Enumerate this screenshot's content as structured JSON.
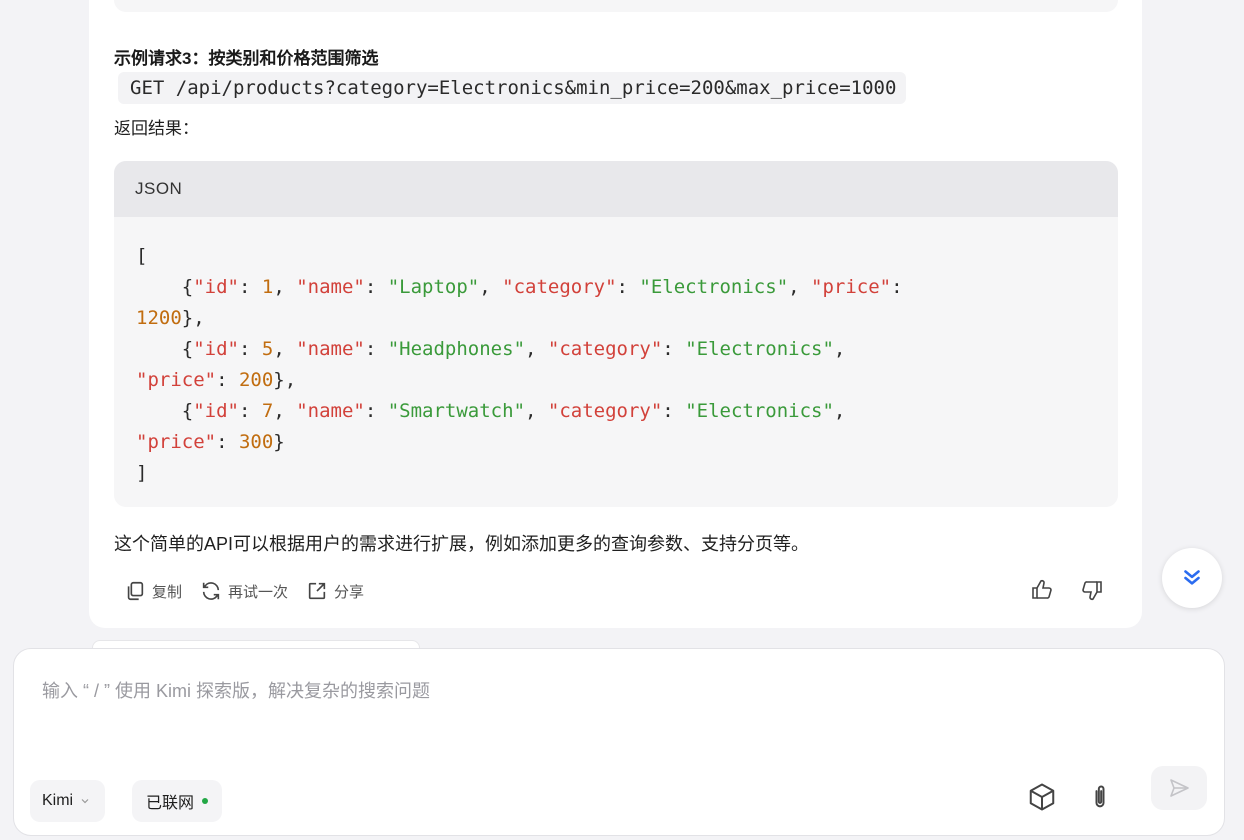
{
  "message": {
    "request_heading": "示例请求3：按类别和价格范围筛选",
    "request_code": "GET /api/products?category=Electronics&min_price=200&max_price=1000",
    "result_label": "返回结果：",
    "code_block": {
      "language": "JSON",
      "lines": [
        [
          {
            "t": "p",
            "v": "["
          }
        ],
        [
          {
            "t": "p",
            "v": "    {"
          },
          {
            "t": "k",
            "v": "\"id\""
          },
          {
            "t": "p",
            "v": ": "
          },
          {
            "t": "n",
            "v": "1"
          },
          {
            "t": "p",
            "v": ", "
          },
          {
            "t": "k",
            "v": "\"name\""
          },
          {
            "t": "p",
            "v": ": "
          },
          {
            "t": "s",
            "v": "\"Laptop\""
          },
          {
            "t": "p",
            "v": ", "
          },
          {
            "t": "k",
            "v": "\"category\""
          },
          {
            "t": "p",
            "v": ": "
          },
          {
            "t": "s",
            "v": "\"Electronics\""
          },
          {
            "t": "p",
            "v": ", "
          },
          {
            "t": "k",
            "v": "\"price\""
          },
          {
            "t": "p",
            "v": ":"
          }
        ],
        [
          {
            "t": "n",
            "v": "1200"
          },
          {
            "t": "p",
            "v": "},"
          }
        ],
        [
          {
            "t": "p",
            "v": "    {"
          },
          {
            "t": "k",
            "v": "\"id\""
          },
          {
            "t": "p",
            "v": ": "
          },
          {
            "t": "n",
            "v": "5"
          },
          {
            "t": "p",
            "v": ", "
          },
          {
            "t": "k",
            "v": "\"name\""
          },
          {
            "t": "p",
            "v": ": "
          },
          {
            "t": "s",
            "v": "\"Headphones\""
          },
          {
            "t": "p",
            "v": ", "
          },
          {
            "t": "k",
            "v": "\"category\""
          },
          {
            "t": "p",
            "v": ": "
          },
          {
            "t": "s",
            "v": "\"Electronics\""
          },
          {
            "t": "p",
            "v": ","
          }
        ],
        [
          {
            "t": "k",
            "v": "\"price\""
          },
          {
            "t": "p",
            "v": ": "
          },
          {
            "t": "n",
            "v": "200"
          },
          {
            "t": "p",
            "v": "},"
          }
        ],
        [
          {
            "t": "p",
            "v": "    {"
          },
          {
            "t": "k",
            "v": "\"id\""
          },
          {
            "t": "p",
            "v": ": "
          },
          {
            "t": "n",
            "v": "7"
          },
          {
            "t": "p",
            "v": ", "
          },
          {
            "t": "k",
            "v": "\"name\""
          },
          {
            "t": "p",
            "v": ": "
          },
          {
            "t": "s",
            "v": "\"Smartwatch\""
          },
          {
            "t": "p",
            "v": ", "
          },
          {
            "t": "k",
            "v": "\"category\""
          },
          {
            "t": "p",
            "v": ": "
          },
          {
            "t": "s",
            "v": "\"Electronics\""
          },
          {
            "t": "p",
            "v": ","
          }
        ],
        [
          {
            "t": "k",
            "v": "\"price\""
          },
          {
            "t": "p",
            "v": ": "
          },
          {
            "t": "n",
            "v": "300"
          },
          {
            "t": "p",
            "v": "}"
          }
        ],
        [
          {
            "t": "p",
            "v": "]"
          }
        ]
      ]
    },
    "footer_text": "这个简单的API可以根据用户的需求进行扩展，例如添加更多的查询参数、支持分页等。",
    "actions": {
      "copy_label": "复制",
      "retry_label": "再试一次",
      "share_label": "分享"
    }
  },
  "input": {
    "placeholder": "输入 “ / ” 使用 Kimi 探索版，解决复杂的搜索问题",
    "model_label": "Kimi",
    "network_label": "已联网"
  },
  "icons": {
    "copy": "copy-icon",
    "retry": "refresh-icon",
    "share": "share-icon",
    "like": "thumbs-up-icon",
    "dislike": "thumbs-down-icon",
    "scroll": "double-chevron-down-icon",
    "cube": "cube-icon",
    "attach": "paperclip-icon",
    "send": "send-icon"
  },
  "colors": {
    "json_key": "#d2413a",
    "json_string": "#3a9a3a",
    "json_number": "#c16d10",
    "scroll_accent": "#2b6cf0",
    "online_dot": "#22a745"
  }
}
